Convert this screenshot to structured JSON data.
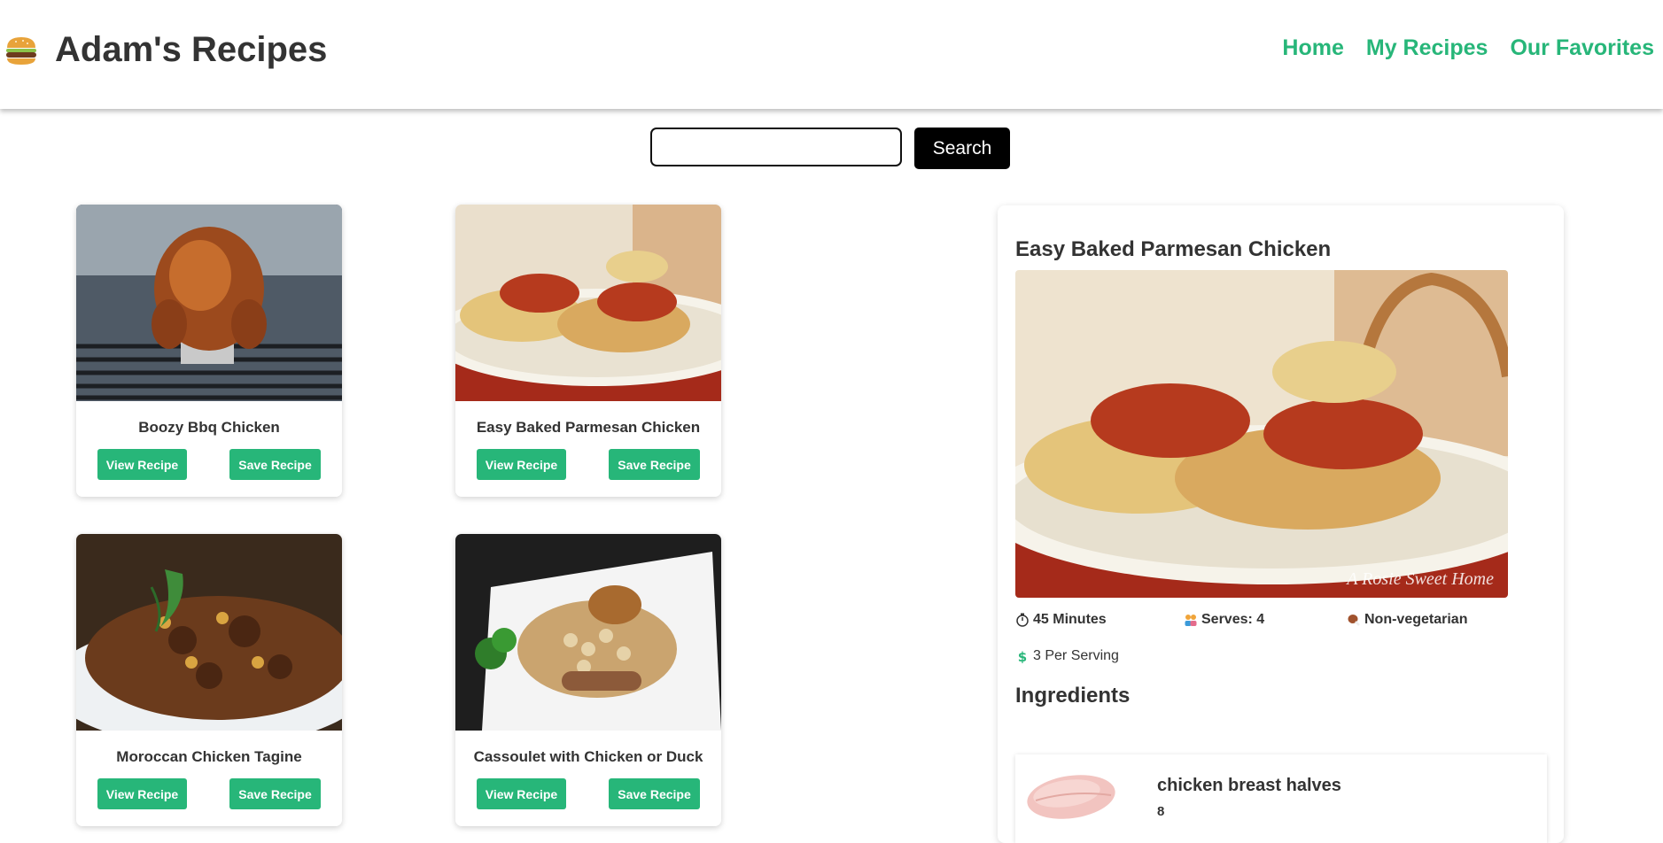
{
  "header": {
    "title": "Adam's Recipes",
    "logo_icon": "burger-icon",
    "nav": [
      "Home",
      "My Recipes",
      "Our Favorites"
    ]
  },
  "search": {
    "value": "",
    "placeholder": "",
    "button_label": "Search"
  },
  "recipes": [
    {
      "title": "Boozy Bbq Chicken",
      "image": "roast-chicken-photo",
      "view_label": "View Recipe",
      "save_label": "Save Recipe"
    },
    {
      "title": "Easy Baked Parmesan Chicken",
      "image": "parmesan-chicken-photo",
      "view_label": "View Recipe",
      "save_label": "Save Recipe"
    },
    {
      "title": "Moroccan Chicken Tagine",
      "image": "chicken-tagine-photo",
      "view_label": "View Recipe",
      "save_label": "Save Recipe"
    },
    {
      "title": "Cassoulet with Chicken or Duck",
      "image": "cassoulet-photo",
      "view_label": "View Recipe",
      "save_label": "Save Recipe"
    }
  ],
  "detail": {
    "title": "Easy Baked Parmesan Chicken",
    "image_watermark": "A Rosie Sweet Home",
    "time": "45 Minutes",
    "serves": "Serves: 4",
    "diet": "Non-vegetarian",
    "price": "3 Per Serving",
    "icons": {
      "time": "stopwatch-icon",
      "serves": "people-icon",
      "diet": "drumstick-icon",
      "price": "dollar-icon"
    },
    "ingredients_heading": "Ingredients",
    "ingredients": [
      {
        "name": "chicken breast halves",
        "amount": "8",
        "image": "chicken-breast-photo"
      }
    ]
  },
  "colors": {
    "accent": "#27b679",
    "search_button": "#000000",
    "text": "#333333"
  }
}
